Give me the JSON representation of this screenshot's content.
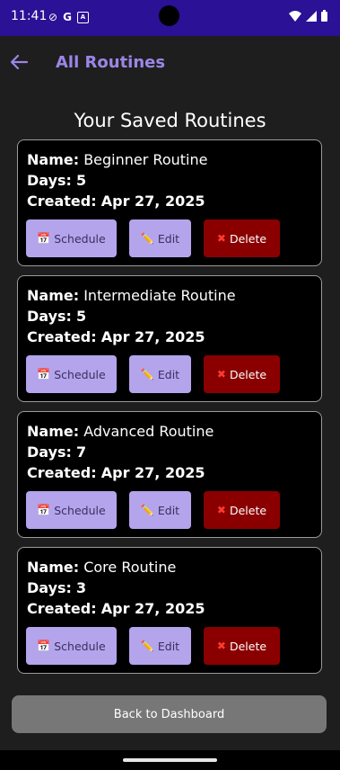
{
  "status_bar": {
    "time": "11:41",
    "g_label": "G",
    "a_label": "A"
  },
  "app_bar": {
    "title": "All Routines"
  },
  "heading": "Your Saved Routines",
  "labels": {
    "name": "Name:",
    "days": "Days:",
    "created": "Created:"
  },
  "buttons": {
    "schedule": "Schedule",
    "edit": "Edit",
    "delete": "Delete"
  },
  "routines": [
    {
      "name": "Beginner Routine",
      "days": "5",
      "created": "Apr 27, 2025"
    },
    {
      "name": "Intermediate Routine",
      "days": "5",
      "created": "Apr 27, 2025"
    },
    {
      "name": "Advanced Routine",
      "days": "7",
      "created": "Apr 27, 2025"
    },
    {
      "name": "Core Routine",
      "days": "3",
      "created": "Apr 27, 2025"
    }
  ],
  "footer": {
    "back_label": "Back to Dashboard"
  },
  "colors": {
    "status_bar": "#2a1196",
    "accent": "#9b86e6",
    "button_light": "#b4a4ec",
    "delete": "#8a0000",
    "background": "#1e1e1e"
  }
}
